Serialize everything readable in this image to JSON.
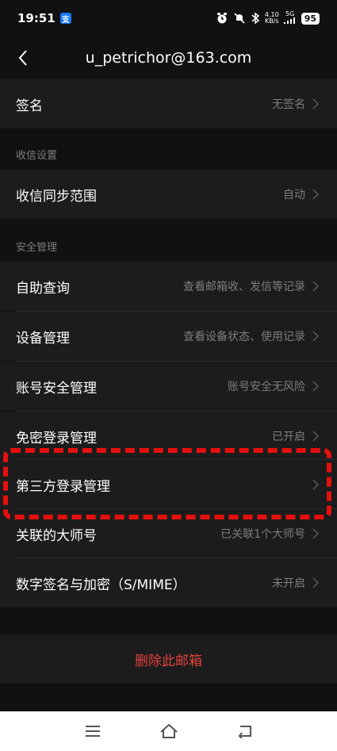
{
  "status_bar": {
    "time": "19:51",
    "alipay_badge": "支",
    "speed_value": "4.10",
    "speed_unit": "KB/s",
    "network": "5G",
    "battery": "95"
  },
  "header": {
    "title": "u_petrichor@163.com"
  },
  "signature": {
    "label": "签名",
    "value": "无签名"
  },
  "receive_settings": {
    "section_title": "收信设置",
    "sync_range_label": "收信同步范围",
    "sync_range_value": "自动"
  },
  "security": {
    "section_title": "安全管理",
    "items": [
      {
        "label": "自助查询",
        "value": "查看邮箱收、发信等记录"
      },
      {
        "label": "设备管理",
        "value": "查看设备状态、使用记录"
      },
      {
        "label": "账号安全管理",
        "value": "账号安全无风险"
      },
      {
        "label": "免密登录管理",
        "value": "已开启"
      },
      {
        "label": "第三方登录管理",
        "value": ""
      },
      {
        "label": "关联的大师号",
        "value": "已关联1个大师号"
      },
      {
        "label": "数字签名与加密（S/MIME）",
        "value": "未开启"
      }
    ]
  },
  "delete": {
    "label": "删除此邮箱"
  },
  "colors": {
    "background": "#111111",
    "row": "#1c1c1c",
    "delete_text": "#e1413c",
    "highlight": "#e5100e"
  }
}
